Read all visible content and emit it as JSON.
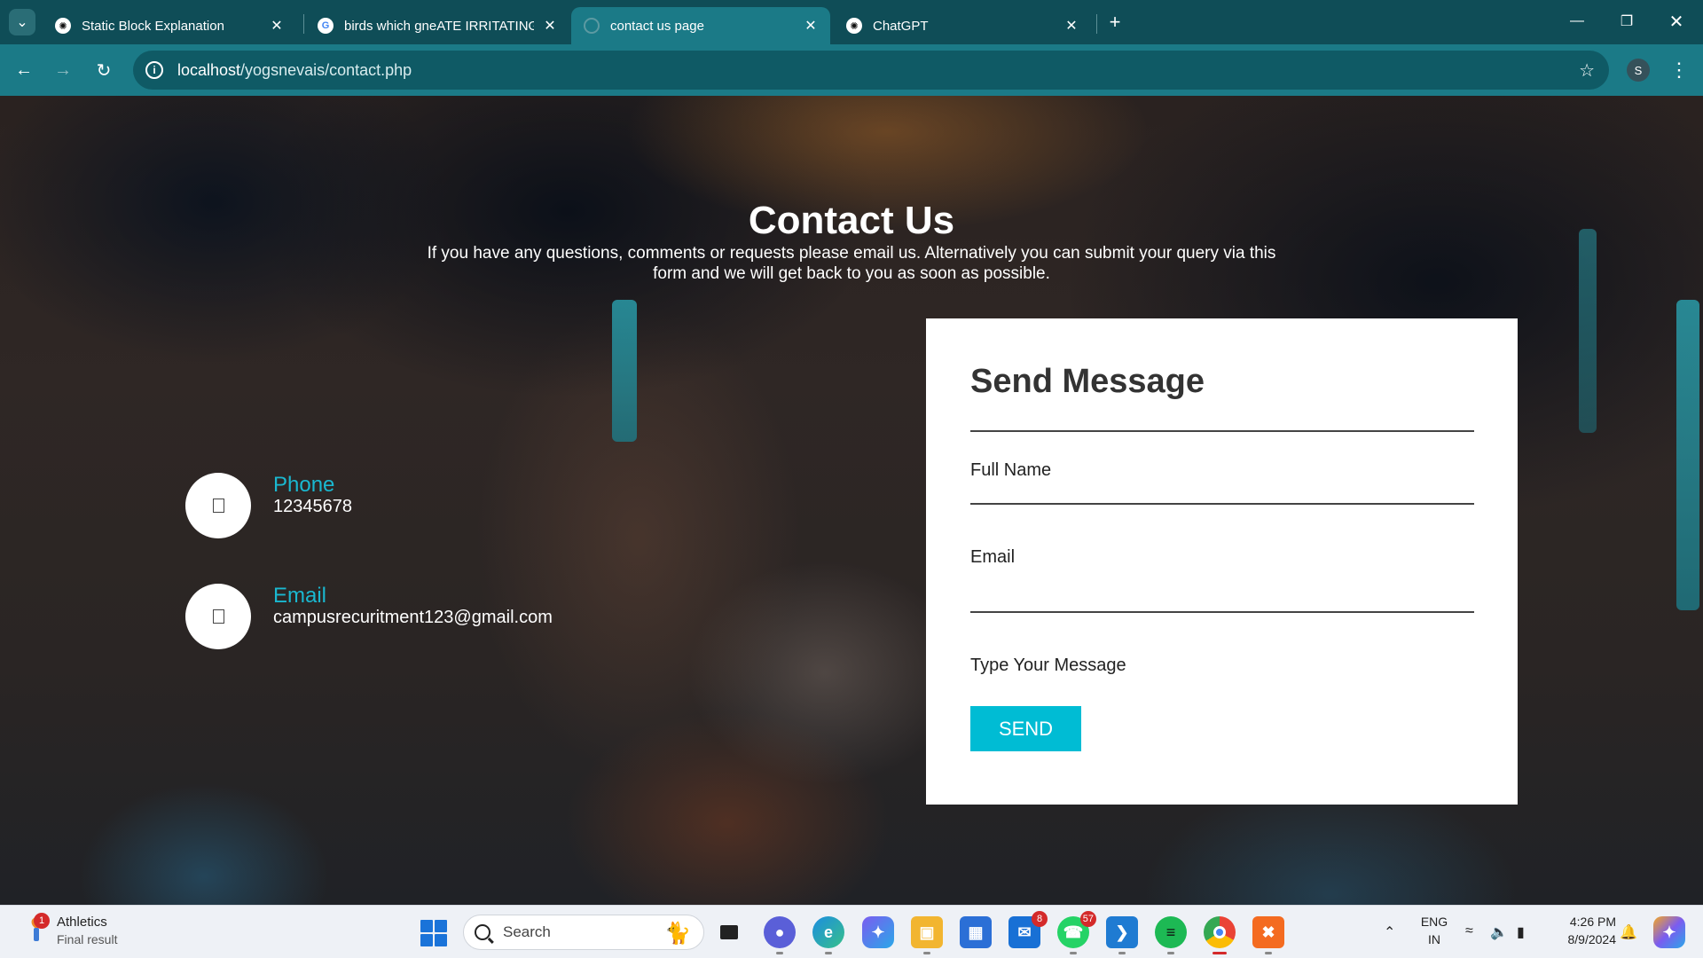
{
  "browser": {
    "tabs": [
      {
        "title": "Static Block Explanation",
        "icon": "chatgpt-icon",
        "active": false
      },
      {
        "title": "birds which gneATE IRRITATING",
        "icon": "google-icon",
        "active": false
      },
      {
        "title": "contact us page",
        "icon": "globe-icon",
        "active": true
      },
      {
        "title": "ChatGPT",
        "icon": "chatgpt-icon",
        "active": false
      }
    ],
    "url_host": "localhost",
    "url_path": "/yogsnevais/contact.php",
    "profile_initial": "S"
  },
  "contact": {
    "title": "Contact Us",
    "intro": "If you have any questions, comments or requests please email us. Alternatively you can submit your query via this form and we will get back to you as soon as possible.",
    "phone_label": "Phone",
    "phone_value": "12345678",
    "email_label": "Email",
    "email_value": "campusrecuritment123@gmail.com"
  },
  "form": {
    "title": "Send Message",
    "full_name_label": "Full Name",
    "email_label": "Email",
    "message_label": "Type Your Message",
    "send_label": "SEND",
    "accent_color": "#00bcd4"
  },
  "taskbar": {
    "widget_title": "Athletics",
    "widget_subtitle": "Final result",
    "widget_badge": "1",
    "search_placeholder": "Search",
    "mail_badge": "8",
    "whatsapp_badge": "57",
    "lang_top": "ENG",
    "lang_bottom": "IN",
    "time": "4:26 PM",
    "date": "8/9/2024"
  }
}
